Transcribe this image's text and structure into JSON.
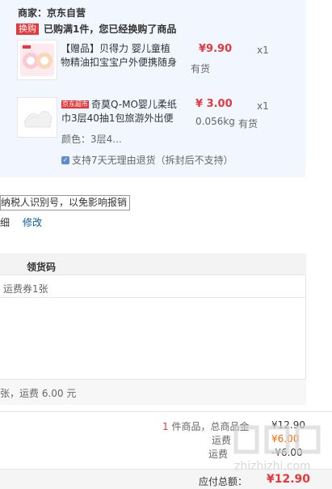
{
  "shop": {
    "merchant_label": "商家：京东自营",
    "swap_badge": "换购",
    "swap_text": "已购满1件，您已经换购了商品"
  },
  "items": [
    {
      "name": "【赠品】贝得力 婴儿童植物精油扣宝宝户外便携随身",
      "price": "¥9.90",
      "qty": "x1",
      "stock": "有货"
    },
    {
      "tag": "京东超市",
      "name": "奇莫Q-MO婴儿柔纸巾3层40抽1包旅游外出便",
      "price": "¥ 3.00",
      "weight": "0.056kg",
      "qty": "x1",
      "stock": "有货",
      "variant": "颜色：3层4..."
    }
  ],
  "return_policy": "支持7天无理由退货（拆封后不支持）",
  "invoice": {
    "tip": "纳税人识别号，以免影响报销",
    "detail": "细",
    "modify_link": "修改"
  },
  "table": {
    "header_code": "领货码",
    "coupon_text": "运费券1张",
    "footer_text": "张，运费 6.00 元"
  },
  "summary": {
    "count_prefix": "1",
    "count_label": " 件商品，总商品金",
    "total_value": "¥12.90",
    "ship_label": "运费",
    "ship_value": "¥6.00",
    "ship2_label": "运费",
    "ship2_value": "-¥6.00",
    "final_label": "应付总额：",
    "final_value": "¥12.90"
  },
  "watermark": "zhizhizhi.com",
  "colors": {
    "accent_red": "#e4393c",
    "link_blue": "#005ea7",
    "panel_bg": "#f2f7ff"
  }
}
